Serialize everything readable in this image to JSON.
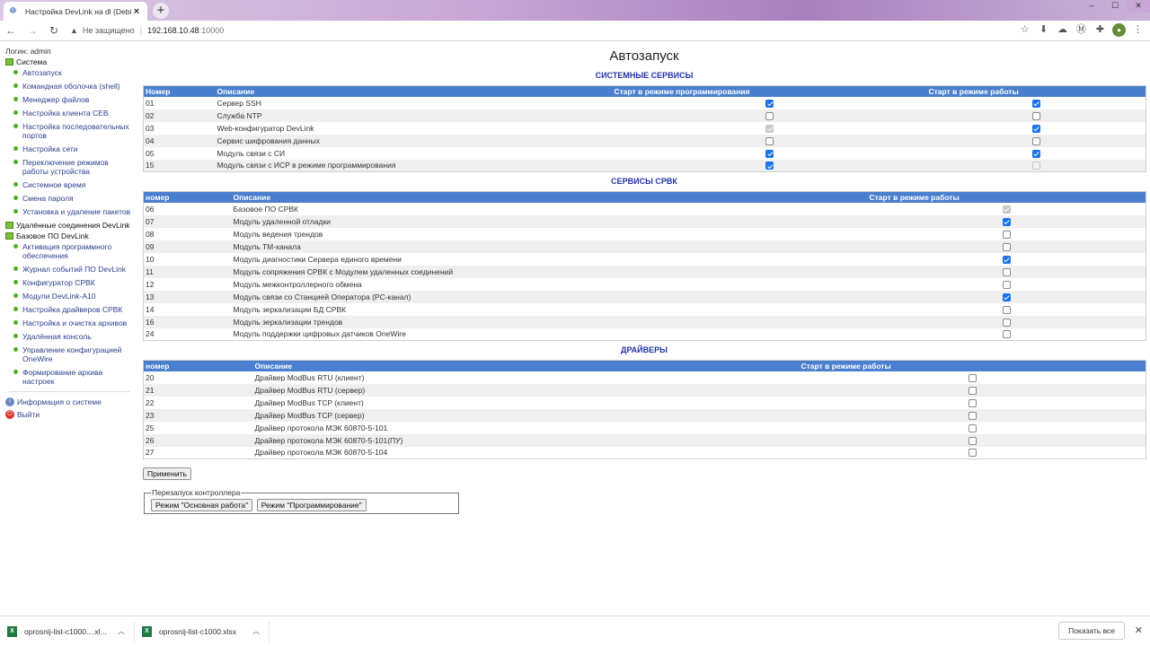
{
  "browser": {
    "tab_title": "Настройка DevLink на dl (Debia",
    "address": {
      "security_label": "Не защищено",
      "host": "192.168.10.48",
      "port": ":10000"
    }
  },
  "sidebar": {
    "login": "Логин: admin",
    "group_system": "Система",
    "system_items": [
      "Автозапуск",
      "Командная оболочка (shell)",
      "Менеджер файлов",
      "Настройка клиента CEB",
      "Настройка последовательных портов",
      "Настройка сети",
      "Переключение режимов работы устройства",
      "Системное время",
      "Смена пароля",
      "Установка и удаление пакетов"
    ],
    "group_remote": "Удалённые соединения DevLink",
    "group_base": "Базовое ПО DevLink",
    "base_items": [
      "Активация программного обеспечения",
      "Журнал событий ПО DevLink",
      "Конфигуратор СРВК",
      "Модули DevLink-A10",
      "Настройка драйверов СРВК",
      "Настройка и очистка архивов",
      "Удалённая консоль",
      "Управление конфигурацией OneWire",
      "Формирование архива настроек"
    ],
    "sysinfo": "Информация о системе",
    "logout": "Выйти"
  },
  "main": {
    "title": "Автозапуск",
    "system_services": {
      "title": "СИСТЕМНЫЕ СЕРВИСЫ",
      "headers": [
        "Номер",
        "Описание",
        "Старт в режиме программирования",
        "Старт в режиме работы"
      ],
      "rows": [
        {
          "num": "01",
          "desc": "Сервер SSH",
          "prog": "on",
          "work": "on"
        },
        {
          "num": "02",
          "desc": "Служба NTP",
          "prog": "off",
          "work": "off"
        },
        {
          "num": "03",
          "desc": "Web-конфигуратор DevLink",
          "prog": "dis-on",
          "work": "on"
        },
        {
          "num": "04",
          "desc": "Сервис шифрования данных",
          "prog": "off",
          "work": "off"
        },
        {
          "num": "05",
          "desc": "Модуль связи с СИ",
          "prog": "on",
          "work": "on"
        },
        {
          "num": "15",
          "desc": "Модуль связи с ИСР в режиме программирования",
          "prog": "on",
          "work": "dis-off"
        }
      ]
    },
    "srvk_services": {
      "title": "СЕРВИСЫ СРВК",
      "headers": [
        "номер",
        "Описание",
        "Старт в режиме работы"
      ],
      "rows": [
        {
          "num": "06",
          "desc": "Базовое ПО СРВК",
          "work": "dis-on"
        },
        {
          "num": "07",
          "desc": "Модуль удаленной отладки",
          "work": "on"
        },
        {
          "num": "08",
          "desc": "Модуль ведения трендов",
          "work": "off"
        },
        {
          "num": "09",
          "desc": "Модуль ТМ-канала",
          "work": "off"
        },
        {
          "num": "10",
          "desc": "Модуль диагностики Сервера единого времени",
          "work": "on"
        },
        {
          "num": "11",
          "desc": "Модуль сопряжения СРВК с Модулем удаленных соединений",
          "work": "off"
        },
        {
          "num": "12",
          "desc": "Модуль межконтроллерного обмена",
          "work": "off"
        },
        {
          "num": "13",
          "desc": "Модуль связи со Станцией Оператора (PC-канал)",
          "work": "on"
        },
        {
          "num": "14",
          "desc": "Модуль зеркализации БД СРВК",
          "work": "off"
        },
        {
          "num": "16",
          "desc": "Модуль зеркализации трендов",
          "work": "off"
        },
        {
          "num": "24",
          "desc": "Модуль поддержки цифровых датчиков OneWire",
          "work": "off"
        }
      ]
    },
    "drivers": {
      "title": "ДРАЙВЕРЫ",
      "headers": [
        "номер",
        "Описание",
        "Старт в режиме работы"
      ],
      "rows": [
        {
          "num": "20",
          "desc": "Драйвер ModBus RTU (клиент)",
          "work": "off"
        },
        {
          "num": "21",
          "desc": "Драйвер ModBus RTU (сервер)",
          "work": "off"
        },
        {
          "num": "22",
          "desc": "Драйвер ModBus TCP (клиент)",
          "work": "off"
        },
        {
          "num": "23",
          "desc": "Драйвер ModBus TCP (сервер)",
          "work": "off"
        },
        {
          "num": "25",
          "desc": "Драйвер протокола МЭК 60870-5-101",
          "work": "off"
        },
        {
          "num": "26",
          "desc": "Драйвер протокола МЭК 60870-5-101(ПУ)",
          "work": "off"
        },
        {
          "num": "27",
          "desc": "Драйвер протокола МЭК 60870-5-104",
          "work": "off"
        }
      ]
    },
    "apply_label": "Применить",
    "restart": {
      "legend": "Перезапуск контроллера",
      "main_mode": "Режим \"Основная работа\"",
      "prog_mode": "Режим \"Программирование\""
    }
  },
  "downloads": {
    "items": [
      "oprosnij-list-c1000....xl...",
      "oprosnij-list-c1000.xlsx"
    ],
    "show_all": "Показать все"
  }
}
